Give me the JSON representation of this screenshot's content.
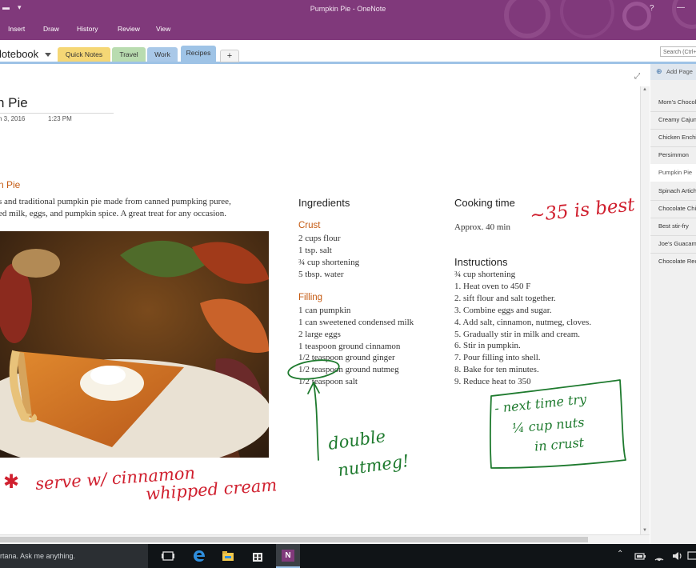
{
  "window": {
    "title": "Pumpkin Pie - OneNote",
    "help_glyph": "?",
    "minimize_glyph": "—"
  },
  "ribbon": {
    "menu": [
      "Insert",
      "Draw",
      "History",
      "Review",
      "View"
    ]
  },
  "notebook": {
    "name": "lotebook",
    "tabs": [
      {
        "label": "Quick Notes",
        "color": "#f5d775"
      },
      {
        "label": "Travel",
        "color": "#b9dcb0"
      },
      {
        "label": "Work",
        "color": "#a9c8e8"
      },
      {
        "label": "Recipes",
        "color": "#9ec3e6"
      }
    ],
    "add_tab": "+",
    "search_placeholder": "Search (Ctrl+"
  },
  "page": {
    "title": "n Pie",
    "date": "h 3, 2016",
    "time": "1:23 PM",
    "section_heading": "n Pie",
    "description": [
      "s and traditional pumpkin pie made from canned pumpking puree,",
      "ed milk, eggs, and pumpkin spice. A great treat for any occasion."
    ],
    "ingredients": {
      "heading": "Ingredients",
      "crust_heading": "Crust",
      "crust": [
        "2 cups flour",
        "1 tsp. salt",
        "¾ cup shortening",
        "5 tbsp. water"
      ],
      "filling_heading": "Filling",
      "filling": [
        "1 can pumpkin",
        "1 can sweetened condensed milk",
        "2 large eggs",
        "1 teaspoon ground cinnamon",
        "1/2 teaspoon ground ginger",
        "1/2 teaspoon ground nutmeg",
        "1/2 teaspoon salt"
      ]
    },
    "cooking": {
      "heading": "Cooking time",
      "value": "Approx. 40 min"
    },
    "instructions": {
      "heading": "Instructions",
      "lines": [
        "¾ cup shortening",
        "1. Heat oven to 450 F",
        "2. sift flour and salt together.",
        "3. Combine eggs and sugar.",
        "4. Add salt, cinnamon, nutmeg, cloves.",
        "5. Gradually stir in milk and cream.",
        "6. Stir in pumpkin.",
        "7. Pour filling into shell.",
        "8. Bake for ten minutes.",
        "9. Reduce heat to 350"
      ]
    },
    "ink": {
      "time_note": "~35 is best",
      "nutmeg_note": [
        "double",
        "nutmeg!"
      ],
      "serve_note": [
        "serve w/ cinnamon",
        "whipped cream"
      ],
      "crust_note": [
        "- next time try",
        "¼ cup nuts",
        "in crust"
      ],
      "star": "✱"
    }
  },
  "pages_pane": {
    "add_label": "Add Page",
    "items": [
      "Mom's Chocolate",
      "Creamy Cajun",
      "Chicken Enchiladas",
      "Persimmon",
      "Pumpkin Pie",
      "Spinach Artichoke",
      "Chocolate Chip",
      "Best stir-fry",
      "Joe's Guacamole",
      "Chocolate Recipe"
    ],
    "selected_index": 4
  },
  "taskbar": {
    "cortana": "rtana. Ask me anything.",
    "onenote_label": "N"
  },
  "colors": {
    "titlebar": "#80397b",
    "orange_heading": "#c55a11",
    "ink_red": "#d0202f",
    "ink_green": "#1e7a2e"
  }
}
